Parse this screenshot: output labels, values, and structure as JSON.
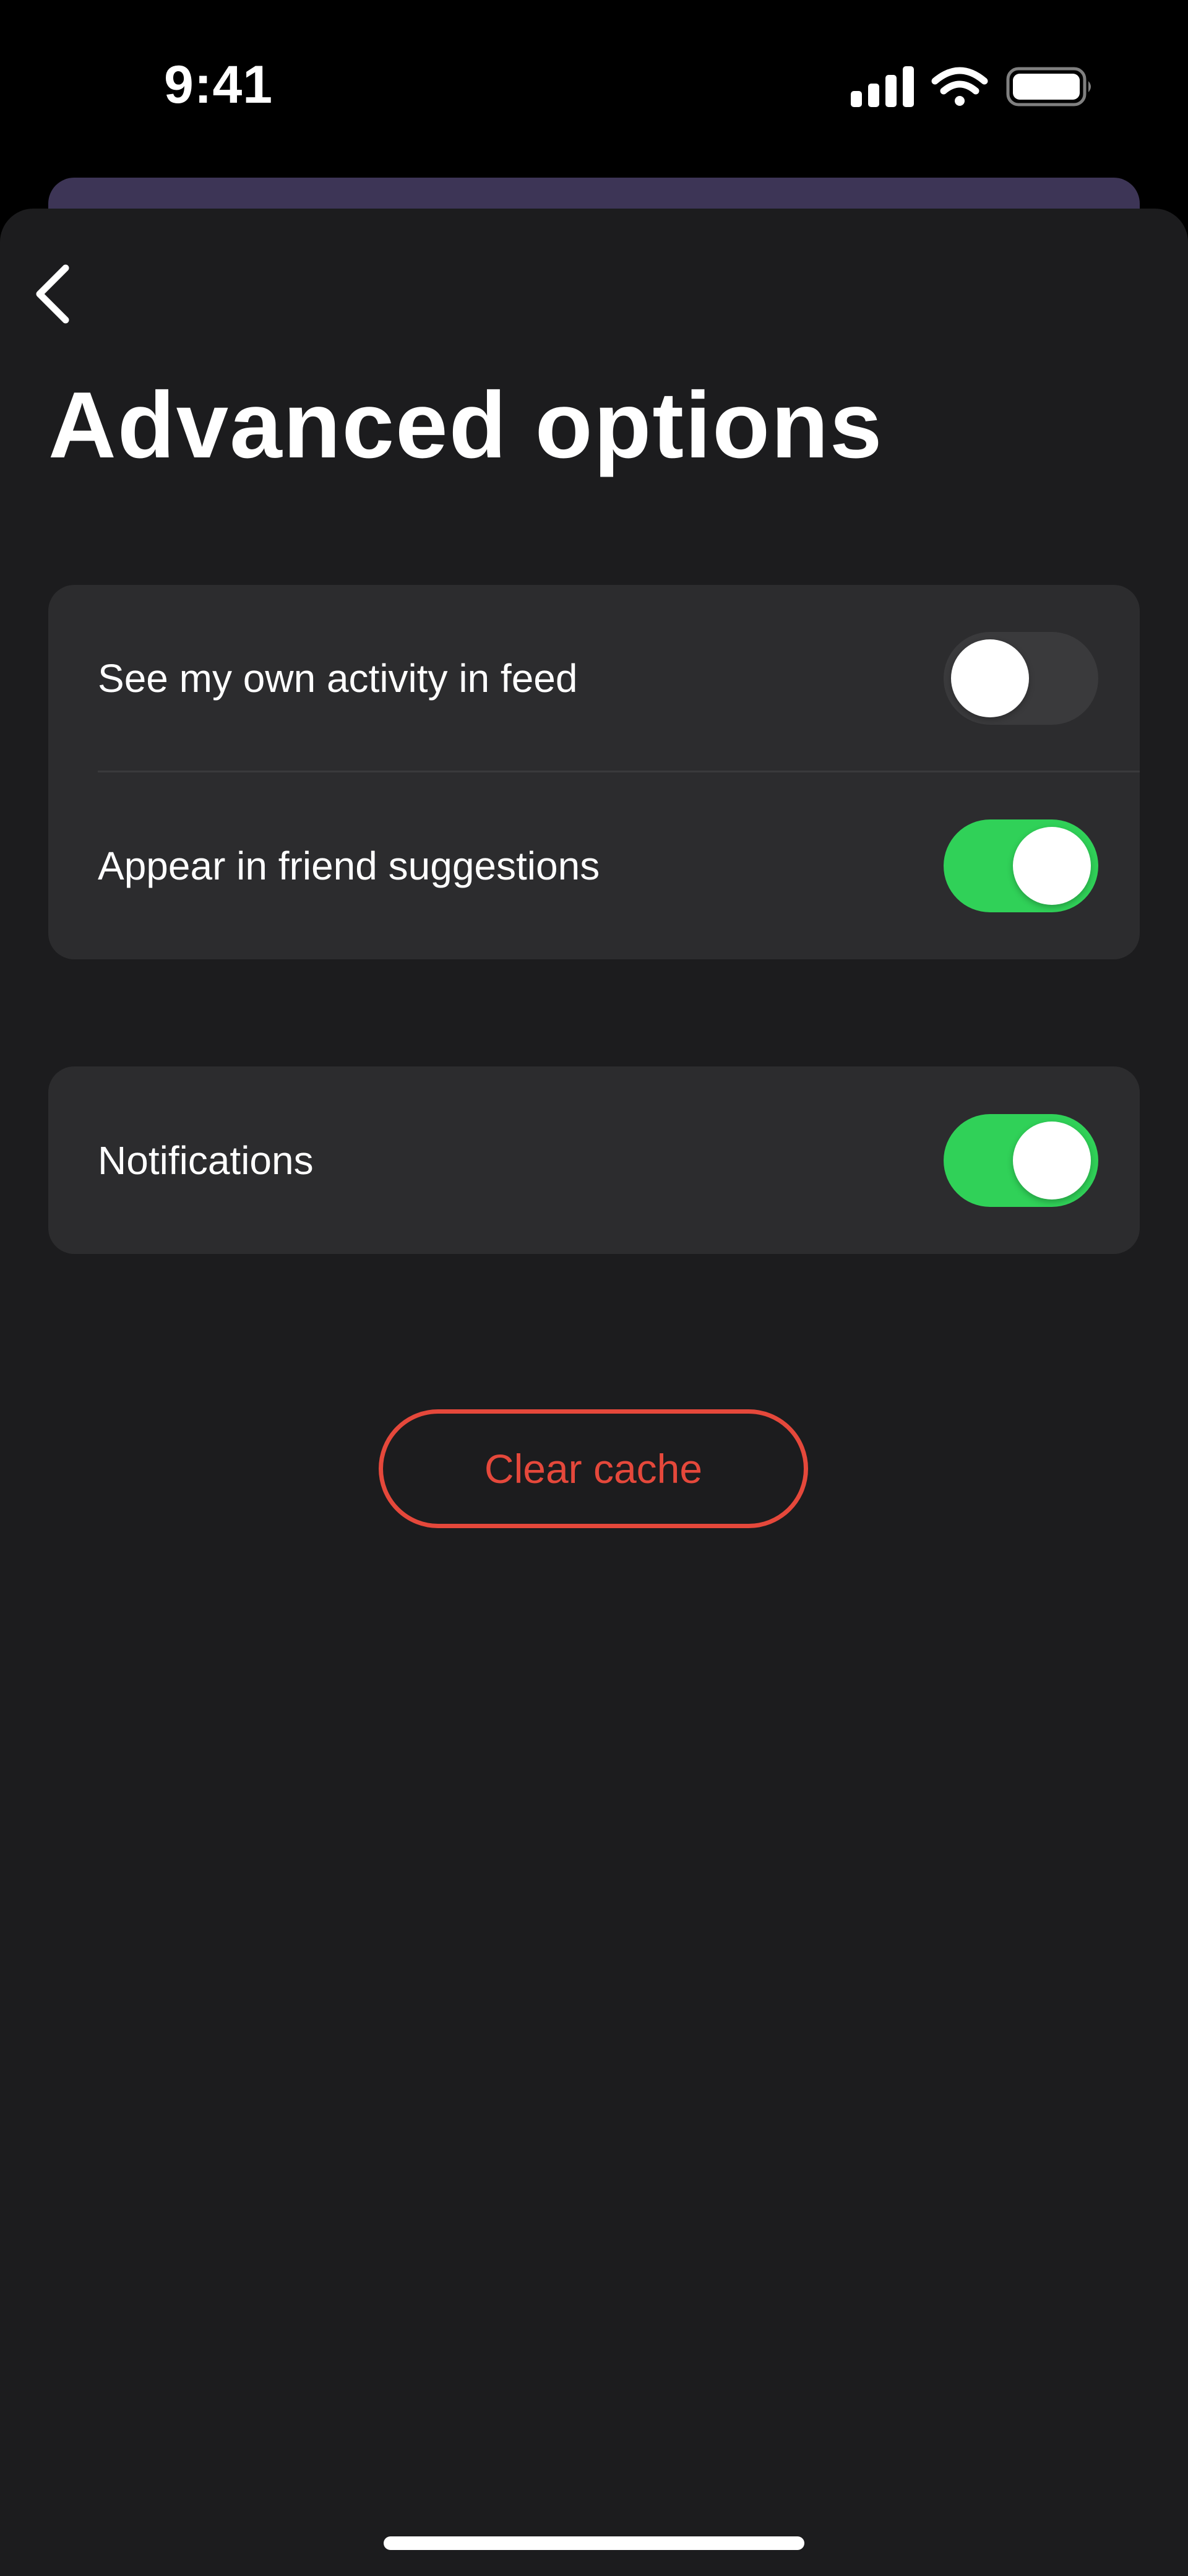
{
  "status_bar": {
    "time": "9:41",
    "icons": [
      "cellular-signal-icon",
      "wifi-icon",
      "battery-icon"
    ]
  },
  "header": {
    "back_icon": "chevron-left-icon",
    "title": "Advanced options"
  },
  "settings": {
    "group1": [
      {
        "label": "See my own activity in feed",
        "enabled": false
      },
      {
        "label": "Appear in friend suggestions",
        "enabled": true
      }
    ],
    "group2": [
      {
        "label": "Notifications",
        "enabled": true
      }
    ]
  },
  "actions": {
    "clear_cache_label": "Clear cache"
  },
  "colors": {
    "background": "#1c1c1e",
    "card": "#2c2c2e",
    "toggle_on": "#30d158",
    "toggle_off": "#3a3a3c",
    "destructive": "#e5483b",
    "backdrop_sheet": "#3d3556"
  }
}
